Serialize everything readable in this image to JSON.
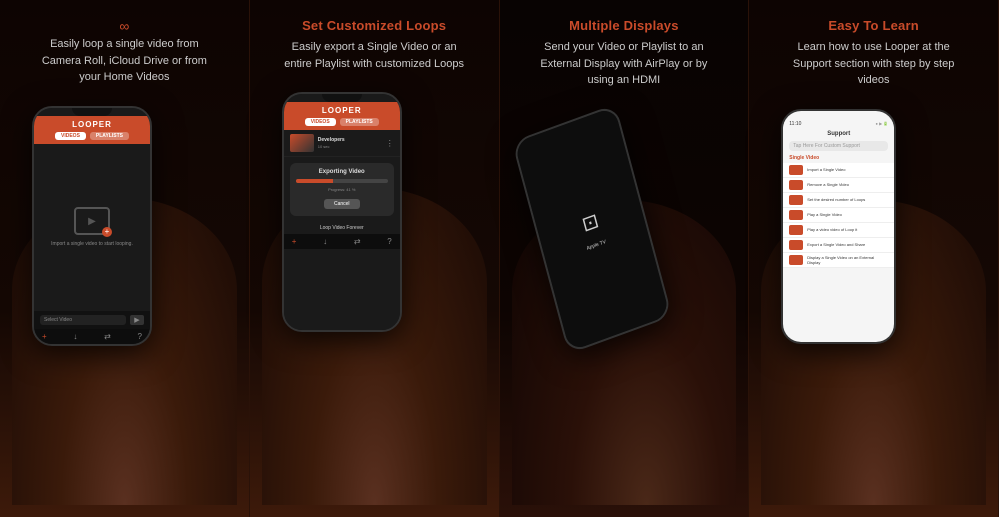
{
  "panels": [
    {
      "id": "panel-1",
      "title": "",
      "description": "Easily loop a single video from Camera Roll, iCloud Drive or from your Home Videos",
      "screen": {
        "logo": "LOOPER",
        "tabs": [
          "VIDEOS",
          "PLAYLISTS"
        ],
        "active_tab": 0,
        "body_text": "Import a single video to start looping.",
        "select_label": "Select Video",
        "bottom_icons": [
          "+",
          "↓",
          "⇄",
          "?"
        ]
      }
    },
    {
      "id": "panel-2",
      "title": "Set Customized Loops",
      "description": "Easily export a Single Video or an entire Playlist with customized Loops",
      "screen": {
        "logo": "LOOPER",
        "tabs": [
          "VIDEOS",
          "PLAYLISTS"
        ],
        "active_tab": 0,
        "list_item_title": "Developers",
        "list_item_sub": "10 sec",
        "export_title": "Exporting Video",
        "progress_label": "Progress: 41 %",
        "cancel_label": "Cancel",
        "loop_label": "Loop Video Forever",
        "bottom_icons": [
          "+",
          "↓",
          "⇄",
          "?"
        ]
      }
    },
    {
      "id": "panel-3",
      "title": "Multiple Displays",
      "description": "Send your Video or Playlist to an External Display with AirPlay or by using an HDMI",
      "screen": {
        "display_text": "Apple TV"
      }
    },
    {
      "id": "panel-4",
      "title": "Easy To Learn",
      "description": "Learn how to use Looper at the Support section with step by step videos",
      "screen": {
        "time": "11:10",
        "header_title": "Support",
        "search_placeholder": "Tap Here For Custom Support",
        "section_label": "Single Video",
        "items": [
          "Import a Single Video",
          "Remove a Single Video",
          "Set the desired number of Loops",
          "Play a Single Video",
          "Play a video video of Loop it",
          "Export a Single Video and Share",
          "Display a Single Video on an External Display"
        ]
      }
    }
  ]
}
